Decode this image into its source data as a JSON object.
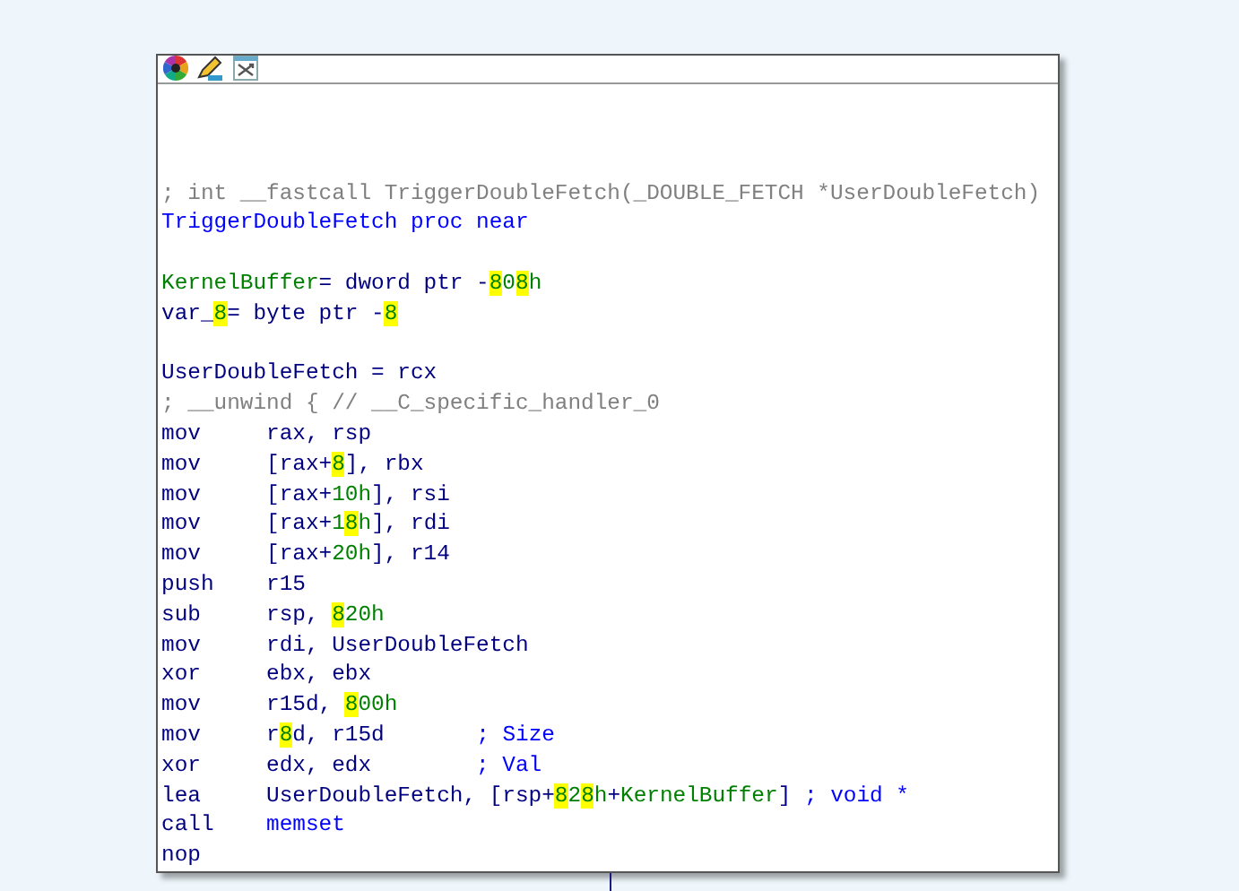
{
  "node": {
    "toolbar": [
      {
        "kind": "palette"
      },
      {
        "kind": "pencil"
      },
      {
        "kind": "graph"
      }
    ],
    "lines": [
      {
        "kind": "text",
        "segments": [
          {
            "kind": "comment",
            "text": "; int __fastcall TriggerDoubleFetch(_DOUBLE_FETCH *UserDoubleFetch)"
          }
        ]
      },
      {
        "kind": "text",
        "segments": [
          {
            "kind": "name",
            "text": "TriggerDoubleFetch proc near"
          }
        ]
      },
      {
        "kind": "blank"
      },
      {
        "kind": "text",
        "segments": [
          {
            "kind": "var",
            "text": "KernelBuffer"
          },
          {
            "kind": "text",
            "text": "= dword ptr -"
          },
          {
            "kind": "hl",
            "text": "8"
          },
          {
            "kind": "num",
            "text": "0"
          },
          {
            "kind": "hl",
            "text": "8"
          },
          {
            "kind": "num",
            "text": "h"
          }
        ]
      },
      {
        "kind": "text",
        "segments": [
          {
            "kind": "text",
            "text": "var_"
          },
          {
            "kind": "hl",
            "text": "8"
          },
          {
            "kind": "text",
            "text": "= byte ptr -"
          },
          {
            "kind": "hl",
            "text": "8"
          }
        ]
      },
      {
        "kind": "blank"
      },
      {
        "kind": "text",
        "segments": [
          {
            "kind": "text",
            "text": "UserDoubleFetch = rcx"
          }
        ]
      },
      {
        "kind": "text",
        "segments": [
          {
            "kind": "comment",
            "text": "; __unwind { // __C_specific_handler_0"
          }
        ]
      },
      {
        "kind": "instr",
        "mnemonic": "mov",
        "segments": [
          {
            "kind": "text",
            "text": "rax, rsp"
          }
        ]
      },
      {
        "kind": "instr",
        "mnemonic": "mov",
        "segments": [
          {
            "kind": "text",
            "text": "[rax+"
          },
          {
            "kind": "hl",
            "text": "8"
          },
          {
            "kind": "text",
            "text": "], rbx"
          }
        ]
      },
      {
        "kind": "instr",
        "mnemonic": "mov",
        "segments": [
          {
            "kind": "text",
            "text": "[rax+"
          },
          {
            "kind": "num",
            "text": "10h"
          },
          {
            "kind": "text",
            "text": "], rsi"
          }
        ]
      },
      {
        "kind": "instr",
        "mnemonic": "mov",
        "segments": [
          {
            "kind": "text",
            "text": "[rax+"
          },
          {
            "kind": "num",
            "text": "1"
          },
          {
            "kind": "hl",
            "text": "8"
          },
          {
            "kind": "num",
            "text": "h"
          },
          {
            "kind": "text",
            "text": "], rdi"
          }
        ]
      },
      {
        "kind": "instr",
        "mnemonic": "mov",
        "segments": [
          {
            "kind": "text",
            "text": "[rax+"
          },
          {
            "kind": "num",
            "text": "20h"
          },
          {
            "kind": "text",
            "text": "], r14"
          }
        ]
      },
      {
        "kind": "instr",
        "mnemonic": "push",
        "segments": [
          {
            "kind": "text",
            "text": "r15"
          }
        ]
      },
      {
        "kind": "instr",
        "mnemonic": "sub",
        "segments": [
          {
            "kind": "text",
            "text": "rsp, "
          },
          {
            "kind": "hl",
            "text": "8"
          },
          {
            "kind": "num",
            "text": "20h"
          }
        ]
      },
      {
        "kind": "instr",
        "mnemonic": "mov",
        "segments": [
          {
            "kind": "text",
            "text": "rdi, UserDoubleFetch"
          }
        ]
      },
      {
        "kind": "instr",
        "mnemonic": "xor",
        "segments": [
          {
            "kind": "text",
            "text": "ebx, ebx"
          }
        ]
      },
      {
        "kind": "instr",
        "mnemonic": "mov",
        "segments": [
          {
            "kind": "text",
            "text": "r15d, "
          },
          {
            "kind": "hl",
            "text": "8"
          },
          {
            "kind": "num",
            "text": "00h"
          }
        ]
      },
      {
        "kind": "instr",
        "mnemonic": "mov",
        "segments": [
          {
            "kind": "text",
            "text": "r"
          },
          {
            "kind": "hl",
            "text": "8"
          },
          {
            "kind": "text",
            "text": "d, r15d       "
          },
          {
            "kind": "name",
            "text": "; Size"
          }
        ]
      },
      {
        "kind": "instr",
        "mnemonic": "xor",
        "segments": [
          {
            "kind": "text",
            "text": "edx, edx        "
          },
          {
            "kind": "name",
            "text": "; Val"
          }
        ]
      },
      {
        "kind": "instr",
        "mnemonic": "lea",
        "segments": [
          {
            "kind": "text",
            "text": "UserDoubleFetch, [rsp+"
          },
          {
            "kind": "hl",
            "text": "8"
          },
          {
            "kind": "num",
            "text": "2"
          },
          {
            "kind": "hl",
            "text": "8"
          },
          {
            "kind": "num",
            "text": "h"
          },
          {
            "kind": "text",
            "text": "+"
          },
          {
            "kind": "var",
            "text": "KernelBuffer"
          },
          {
            "kind": "text",
            "text": "] "
          },
          {
            "kind": "name",
            "text": "; void *"
          }
        ]
      },
      {
        "kind": "instr",
        "mnemonic": "call",
        "segments": [
          {
            "kind": "name",
            "text": "memset"
          }
        ]
      },
      {
        "kind": "instr",
        "mnemonic": "nop"
      }
    ]
  }
}
